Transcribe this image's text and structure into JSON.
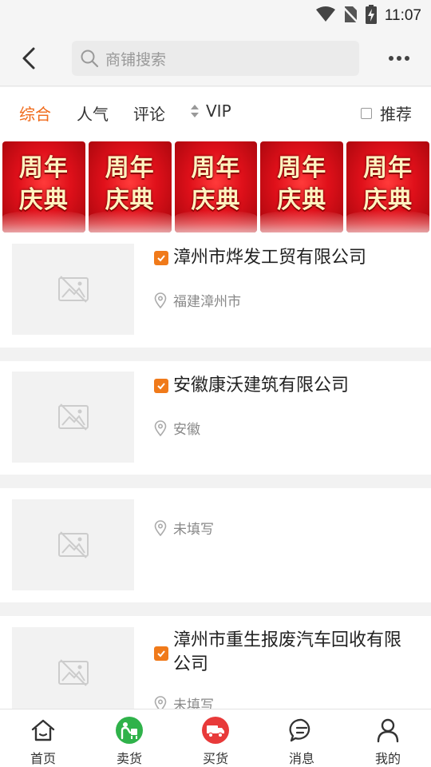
{
  "status_bar": {
    "time": "11:07",
    "icons": [
      "wifi-icon",
      "no-sim-icon",
      "battery-charging-icon"
    ]
  },
  "header": {
    "back_icon": "chevron-left-icon",
    "search_placeholder": "商铺搜索",
    "more_icon": "more-dots-icon"
  },
  "filters": {
    "tabs": [
      {
        "label": "综合",
        "active": true
      },
      {
        "label": "人气",
        "active": false
      },
      {
        "label": "评论",
        "active": false
      }
    ],
    "vip_label": "VIP",
    "recommend_label": "推荐",
    "recommend_checked": false
  },
  "banner": {
    "line1": "周年",
    "line2": "庆典",
    "count": 5
  },
  "shops": [
    {
      "name": "漳州市烨发工贸有限公司",
      "verified": true,
      "location": "福建漳州市"
    },
    {
      "name": "安徽康沃建筑有限公司",
      "verified": true,
      "location": "安徽"
    },
    {
      "name": "",
      "verified": false,
      "location": "未填写"
    },
    {
      "name": "漳州市重生报废汽车回收有限公司",
      "verified": true,
      "location": "未填写"
    }
  ],
  "bottom_nav": [
    {
      "label": "首页",
      "icon": "home-icon"
    },
    {
      "label": "卖货",
      "icon": "sell-icon"
    },
    {
      "label": "买货",
      "icon": "buy-truck-icon"
    },
    {
      "label": "消息",
      "icon": "message-icon"
    },
    {
      "label": "我的",
      "icon": "profile-icon"
    }
  ],
  "colors": {
    "accent": "#f06a1a",
    "sell_icon_bg": "#2fb24a",
    "buy_icon_bg": "#e83a3a",
    "banner_red": "#e0101a"
  }
}
